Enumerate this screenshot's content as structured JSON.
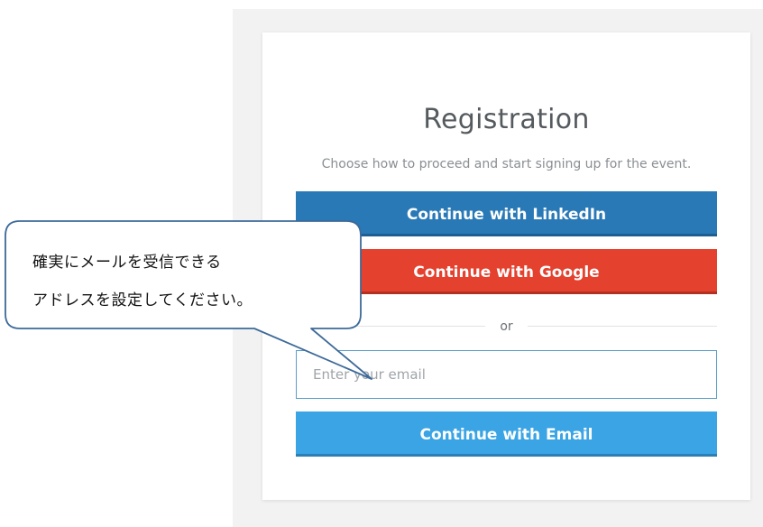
{
  "registration": {
    "title": "Registration",
    "subtitle": "Choose how to proceed and start signing up for the event.",
    "linkedin_button": "Continue with LinkedIn",
    "google_button": "Continue with Google",
    "divider_text": "or",
    "email_placeholder": "Enter your email",
    "email_button": "Continue with Email"
  },
  "callout": {
    "line1": "確実にメールを受信できる",
    "line2": "アドレスを設定してください。"
  },
  "colors": {
    "linkedin": "#2979b6",
    "google": "#e4412f",
    "email": "#3aa4e4",
    "callout_border": "#3d6a99"
  }
}
